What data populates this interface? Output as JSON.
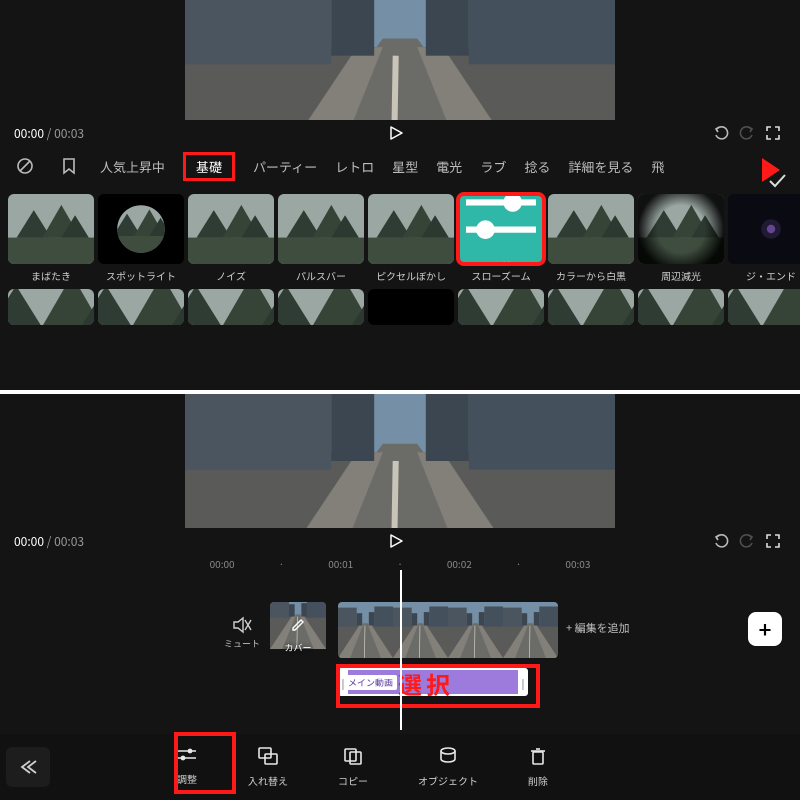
{
  "time": {
    "current": "00:00",
    "total": "00:03"
  },
  "tabs": {
    "items": [
      "人気上昇中",
      "基礎",
      "パーティー",
      "レトロ",
      "星型",
      "電光",
      "ラブ",
      "捻る",
      "詳細を見る",
      "飛"
    ],
    "activeIndex": 1
  },
  "effects": {
    "row1": [
      {
        "label": "まばたき",
        "kind": "landscape"
      },
      {
        "label": "スポットライト",
        "kind": "circle"
      },
      {
        "label": "ノイズ",
        "kind": "landscape"
      },
      {
        "label": "パルスバー",
        "kind": "landscape"
      },
      {
        "label": "ピクセルぼかし",
        "kind": "landscape"
      },
      {
        "label": "スローズーム",
        "kind": "selected",
        "tile_label": "調整"
      },
      {
        "label": "カラーから白黒",
        "kind": "landscape"
      },
      {
        "label": "周辺減光",
        "kind": "landscape"
      },
      {
        "label": "ジ・エンド",
        "kind": "dark"
      }
    ]
  },
  "timeline": {
    "ticks": [
      "00:00",
      "00:01",
      "00:02",
      "00:03"
    ],
    "mute": "ミュート",
    "cover": "カバー",
    "add_edit": "+ 編集を追加",
    "clip_tag": "メイン動画",
    "select_anno": "選択"
  },
  "toolbar": {
    "items": [
      {
        "label": "調整",
        "icon": "sliders"
      },
      {
        "label": "入れ替え",
        "icon": "swap"
      },
      {
        "label": "コピー",
        "icon": "copy"
      },
      {
        "label": "オブジェクト",
        "icon": "object"
      },
      {
        "label": "削除",
        "icon": "trash"
      }
    ]
  }
}
